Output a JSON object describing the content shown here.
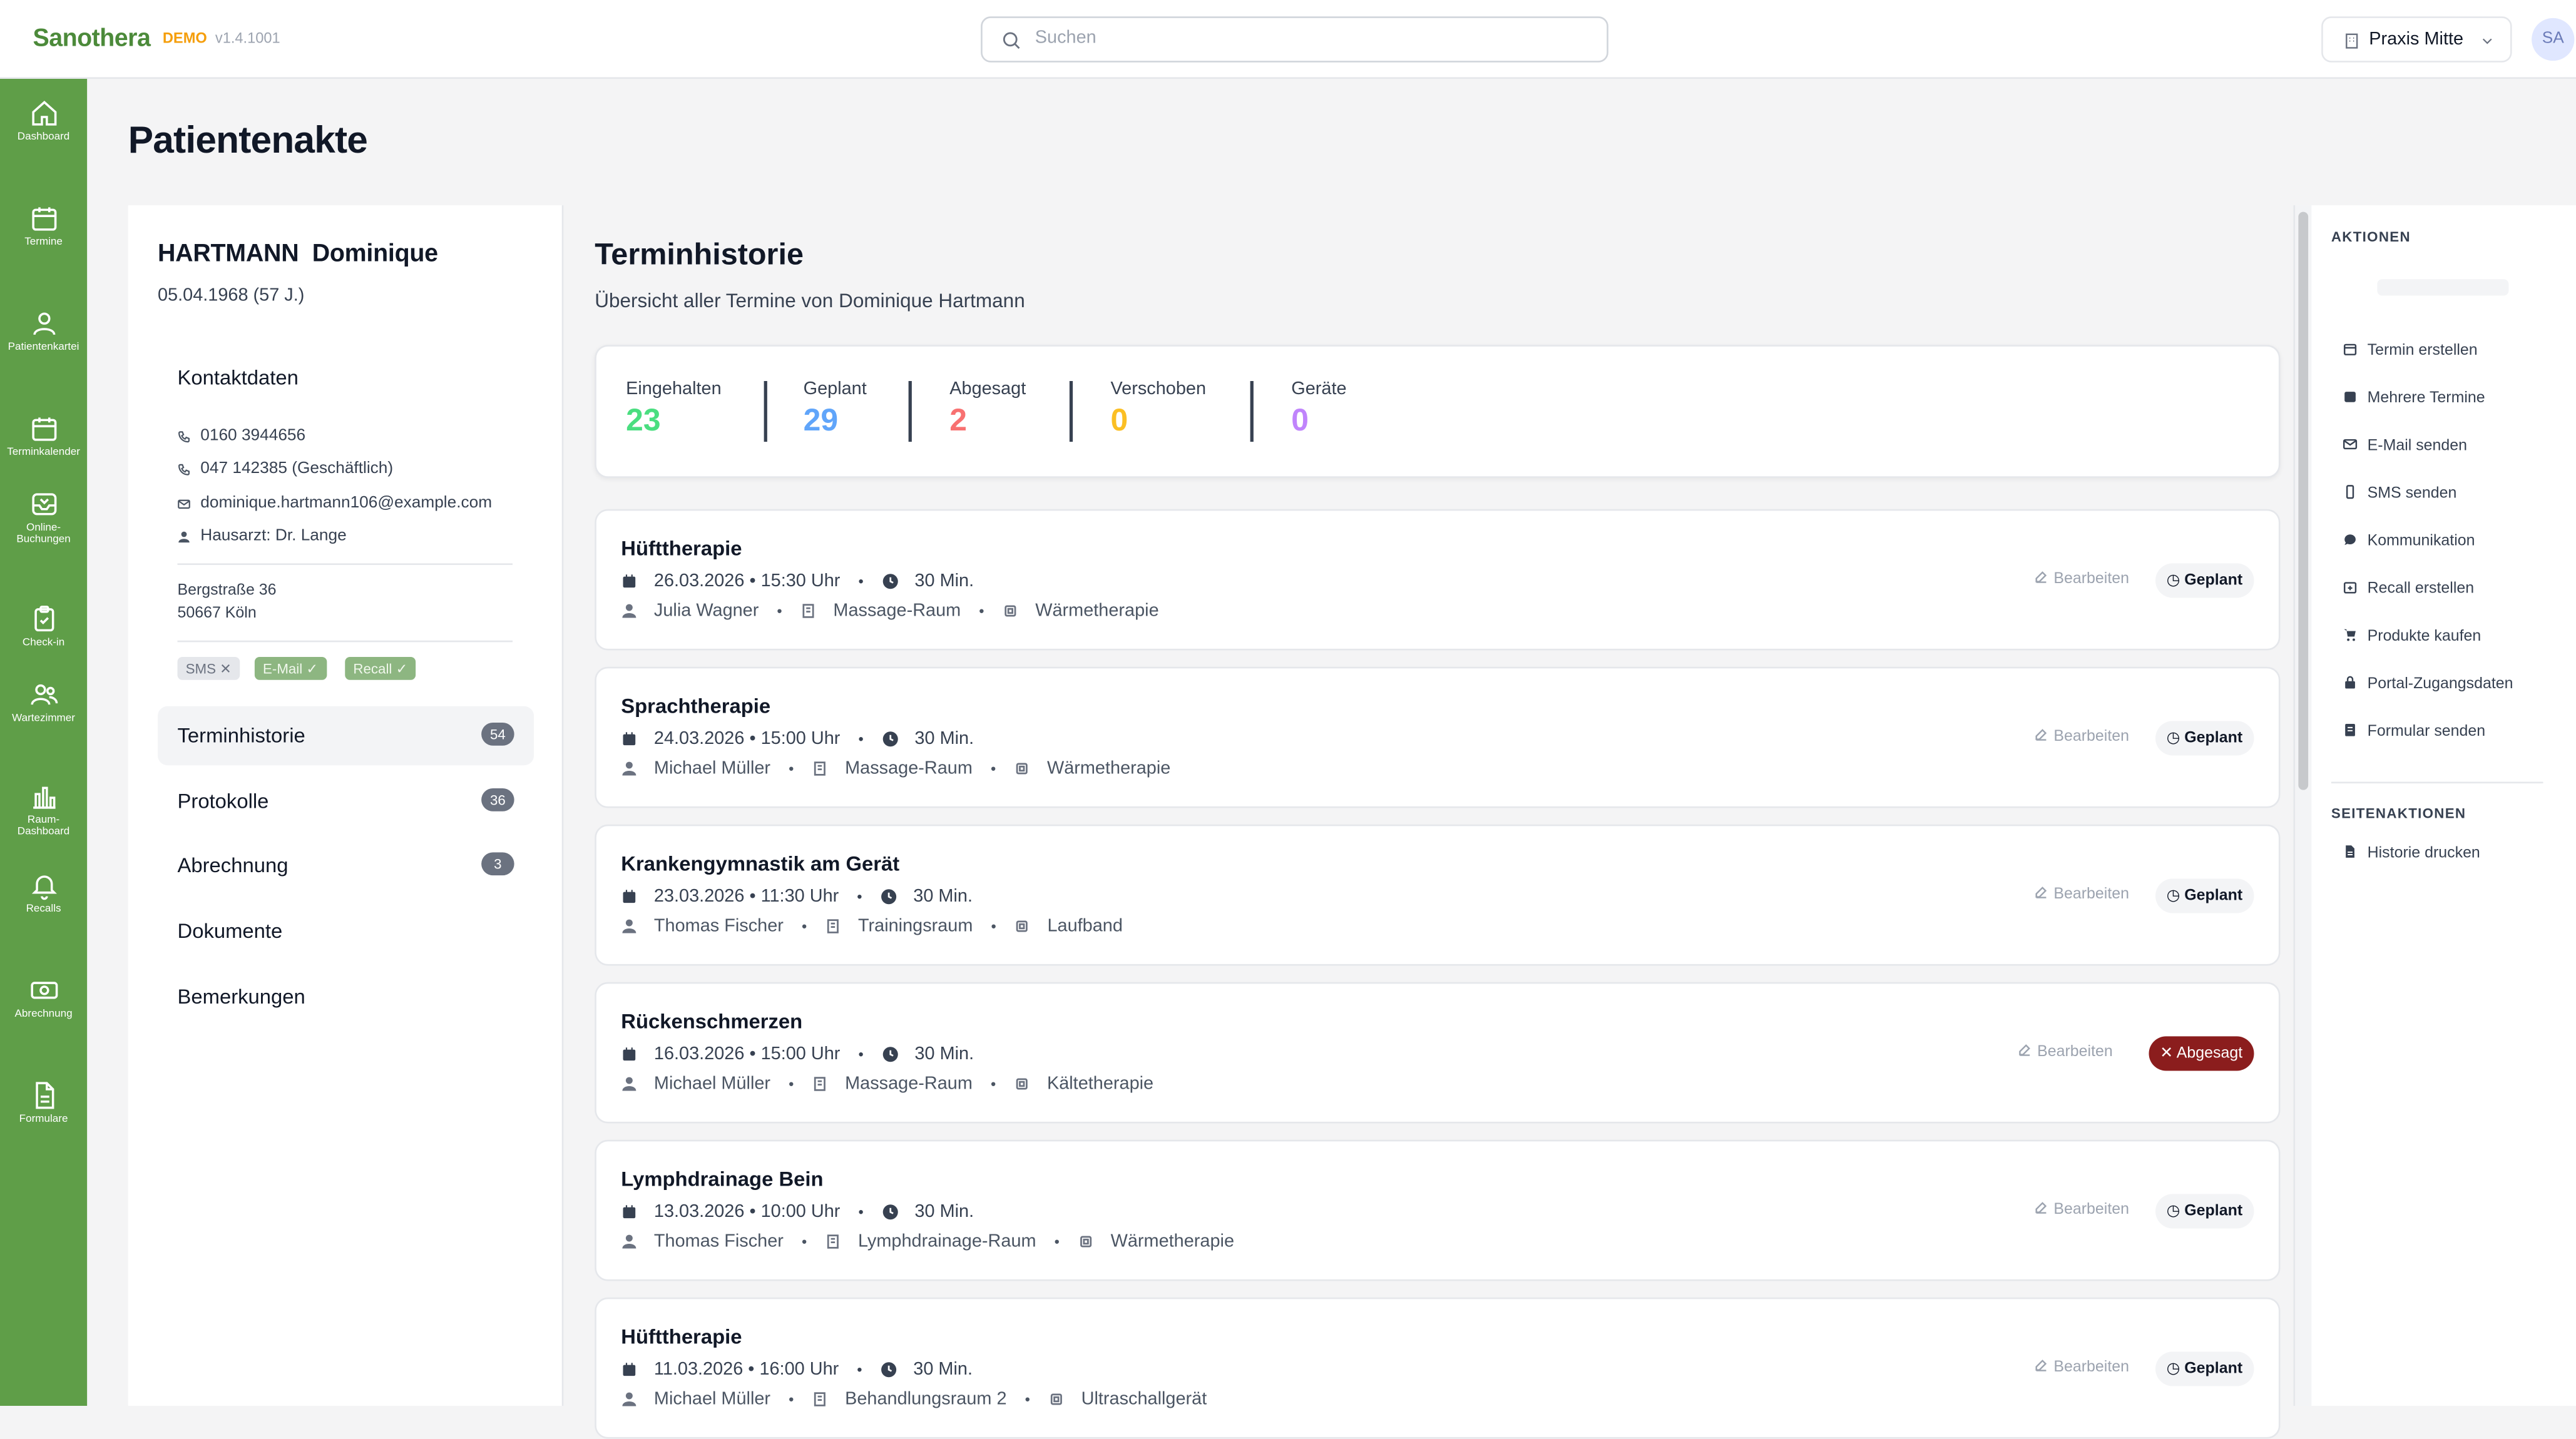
{
  "app": {
    "brand": "Sanothera",
    "demo_label": "DEMO",
    "version": "v1.4.1001"
  },
  "search": {
    "placeholder": "Suchen"
  },
  "practice_selector": {
    "label": "Praxis Mitte"
  },
  "user": {
    "initials": "SA"
  },
  "sidebar": {
    "items": [
      {
        "label": "Dashboard",
        "icon": "home-icon"
      },
      {
        "label": "Termine",
        "icon": "calendar-icon"
      },
      {
        "label": "Patientenkartei",
        "icon": "person-icon"
      },
      {
        "label": "Terminkalender",
        "icon": "calendar-icon"
      },
      {
        "label": "Online-Buchungen",
        "icon": "inbox-icon"
      },
      {
        "label": "Check-in",
        "icon": "clipboard-check-icon"
      },
      {
        "label": "Wartezimmer",
        "icon": "users-icon"
      },
      {
        "label": "Raum-Dashboard",
        "icon": "bar-chart-icon"
      },
      {
        "label": "Recalls",
        "icon": "bell-icon"
      },
      {
        "label": "Abrechnung",
        "icon": "money-icon"
      },
      {
        "label": "Formulare",
        "icon": "document-icon"
      }
    ]
  },
  "page": {
    "title": "Patientenakte"
  },
  "patient": {
    "name": "HARTMANN  Dominique",
    "dob": "05.04.1968 (57 J.)",
    "contact_title": "Kontaktdaten",
    "phone_mobile": "0160 3944656",
    "phone_business": "047 142385 (Geschäftlich)",
    "email": "dominique.hartmann106@example.com",
    "gp": "Hausarzt: Dr. Lange",
    "street": "Bergstraße 36",
    "city": "50667 Köln",
    "chips": {
      "sms": "SMS ✕",
      "email": "E-Mail ✓",
      "recall": "Recall ✓"
    }
  },
  "tabs": [
    {
      "label": "Terminhistorie",
      "count": "54"
    },
    {
      "label": "Protokolle",
      "count": "36"
    },
    {
      "label": "Abrechnung",
      "count": "3"
    },
    {
      "label": "Dokumente",
      "count": ""
    },
    {
      "label": "Bemerkungen",
      "count": ""
    }
  ],
  "history": {
    "title": "Terminhistorie",
    "subtitle": "Übersicht aller Termine von Dominique Hartmann",
    "stats": [
      {
        "label": "Eingehalten",
        "value": "23",
        "color": "#4ade80"
      },
      {
        "label": "Geplant",
        "value": "29",
        "color": "#60a5fa"
      },
      {
        "label": "Abgesagt",
        "value": "2",
        "color": "#f87171"
      },
      {
        "label": "Verschoben",
        "value": "0",
        "color": "#fbbf24"
      },
      {
        "label": "Geräte",
        "value": "0",
        "color": "#c084fc"
      }
    ],
    "edit_label": "Bearbeiten",
    "appointments": [
      {
        "title": "Hüfttherapie",
        "datetime": "26.03.2026 • 15:30 Uhr",
        "duration": "30 Min.",
        "therapist": "Julia Wagner",
        "room": "Massage-Raum",
        "device": "Wärmetherapie",
        "status": "Geplant"
      },
      {
        "title": "Sprachtherapie",
        "datetime": "24.03.2026 • 15:00 Uhr",
        "duration": "30 Min.",
        "therapist": "Michael Müller",
        "room": "Massage-Raum",
        "device": "Wärmetherapie",
        "status": "Geplant"
      },
      {
        "title": "Krankengymnastik am Gerät",
        "datetime": "23.03.2026 • 11:30 Uhr",
        "duration": "30 Min.",
        "therapist": "Thomas Fischer",
        "room": "Trainingsraum",
        "device": "Laufband",
        "status": "Geplant"
      },
      {
        "title": "Rückenschmerzen",
        "datetime": "16.03.2026 • 15:00 Uhr",
        "duration": "30 Min.",
        "therapist": "Michael Müller",
        "room": "Massage-Raum",
        "device": "Kältetherapie",
        "status": "✕ Abgesagt"
      },
      {
        "title": "Lymphdrainage Bein",
        "datetime": "13.03.2026 • 10:00 Uhr",
        "duration": "30 Min.",
        "therapist": "Thomas Fischer",
        "room": "Lymphdrainage-Raum",
        "device": "Wärmetherapie",
        "status": "Geplant"
      },
      {
        "title": "Hüfttherapie",
        "datetime": "11.03.2026 • 16:00 Uhr",
        "duration": "30 Min.",
        "therapist": "Michael Müller",
        "room": "Behandlungsraum 2",
        "device": "Ultraschallgerät",
        "status": "Geplant"
      }
    ]
  },
  "actions": {
    "header": "AKTIONEN",
    "items": [
      "Termin erstellen",
      "Mehrere Termine",
      "E-Mail senden",
      "SMS senden",
      "Kommunikation",
      "Recall erstellen",
      "Produkte kaufen",
      "Portal-Zugangsdaten",
      "Formular senden"
    ],
    "page_header": "SEITENAKTIONEN",
    "page_items": [
      "Historie drucken"
    ]
  }
}
